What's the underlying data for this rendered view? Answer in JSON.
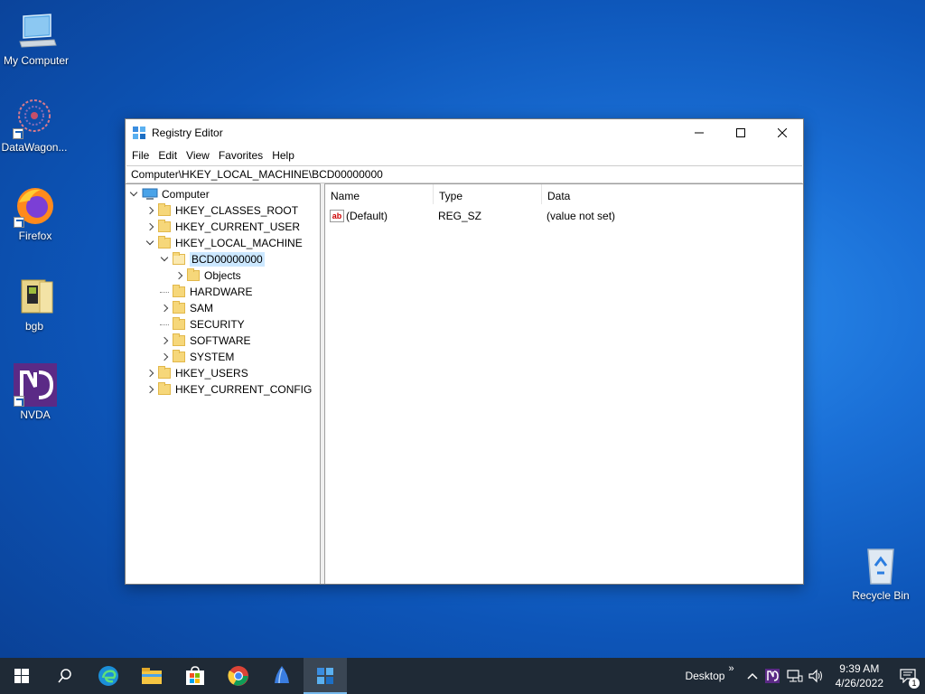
{
  "desktop": {
    "icons": [
      {
        "label": "My Computer",
        "icon": "computer-icon"
      },
      {
        "label": "DataWagon...",
        "icon": "datawagon-icon"
      },
      {
        "label": "Firefox",
        "icon": "firefox-icon"
      },
      {
        "label": "bgb",
        "icon": "bgb-icon"
      },
      {
        "label": "NVDA",
        "icon": "nvda-icon"
      },
      {
        "label": "Recycle Bin",
        "icon": "recycle-bin-icon"
      }
    ]
  },
  "window": {
    "title": "Registry Editor",
    "controls": {
      "minimize": "—",
      "maximize": "☐",
      "close": "✕"
    },
    "menu": [
      "File",
      "Edit",
      "View",
      "Favorites",
      "Help"
    ],
    "address": "Computer\\HKEY_LOCAL_MACHINE\\BCD00000000",
    "tree": {
      "root": "Computer",
      "items": [
        {
          "label": "HKEY_CLASSES_ROOT",
          "level": 1,
          "expander": "collapsed"
        },
        {
          "label": "HKEY_CURRENT_USER",
          "level": 1,
          "expander": "collapsed"
        },
        {
          "label": "HKEY_LOCAL_MACHINE",
          "level": 1,
          "expander": "expanded"
        },
        {
          "label": "BCD00000000",
          "level": 2,
          "expander": "expanded",
          "selected": true
        },
        {
          "label": "Objects",
          "level": 3,
          "expander": "collapsed"
        },
        {
          "label": "HARDWARE",
          "level": 2,
          "expander": "none"
        },
        {
          "label": "SAM",
          "level": 2,
          "expander": "collapsed"
        },
        {
          "label": "SECURITY",
          "level": 2,
          "expander": "none"
        },
        {
          "label": "SOFTWARE",
          "level": 2,
          "expander": "collapsed"
        },
        {
          "label": "SYSTEM",
          "level": 2,
          "expander": "collapsed"
        },
        {
          "label": "HKEY_USERS",
          "level": 1,
          "expander": "collapsed"
        },
        {
          "label": "HKEY_CURRENT_CONFIG",
          "level": 1,
          "expander": "collapsed"
        }
      ]
    },
    "list": {
      "columns": [
        "Name",
        "Type",
        "Data"
      ],
      "rows": [
        {
          "name": "(Default)",
          "type": "REG_SZ",
          "data": "(value not set)"
        }
      ]
    }
  },
  "taskbar": {
    "desktop_label": "Desktop",
    "chevron": "»",
    "time": "9:39 AM",
    "date": "4/26/2022",
    "notification_count": "1"
  }
}
